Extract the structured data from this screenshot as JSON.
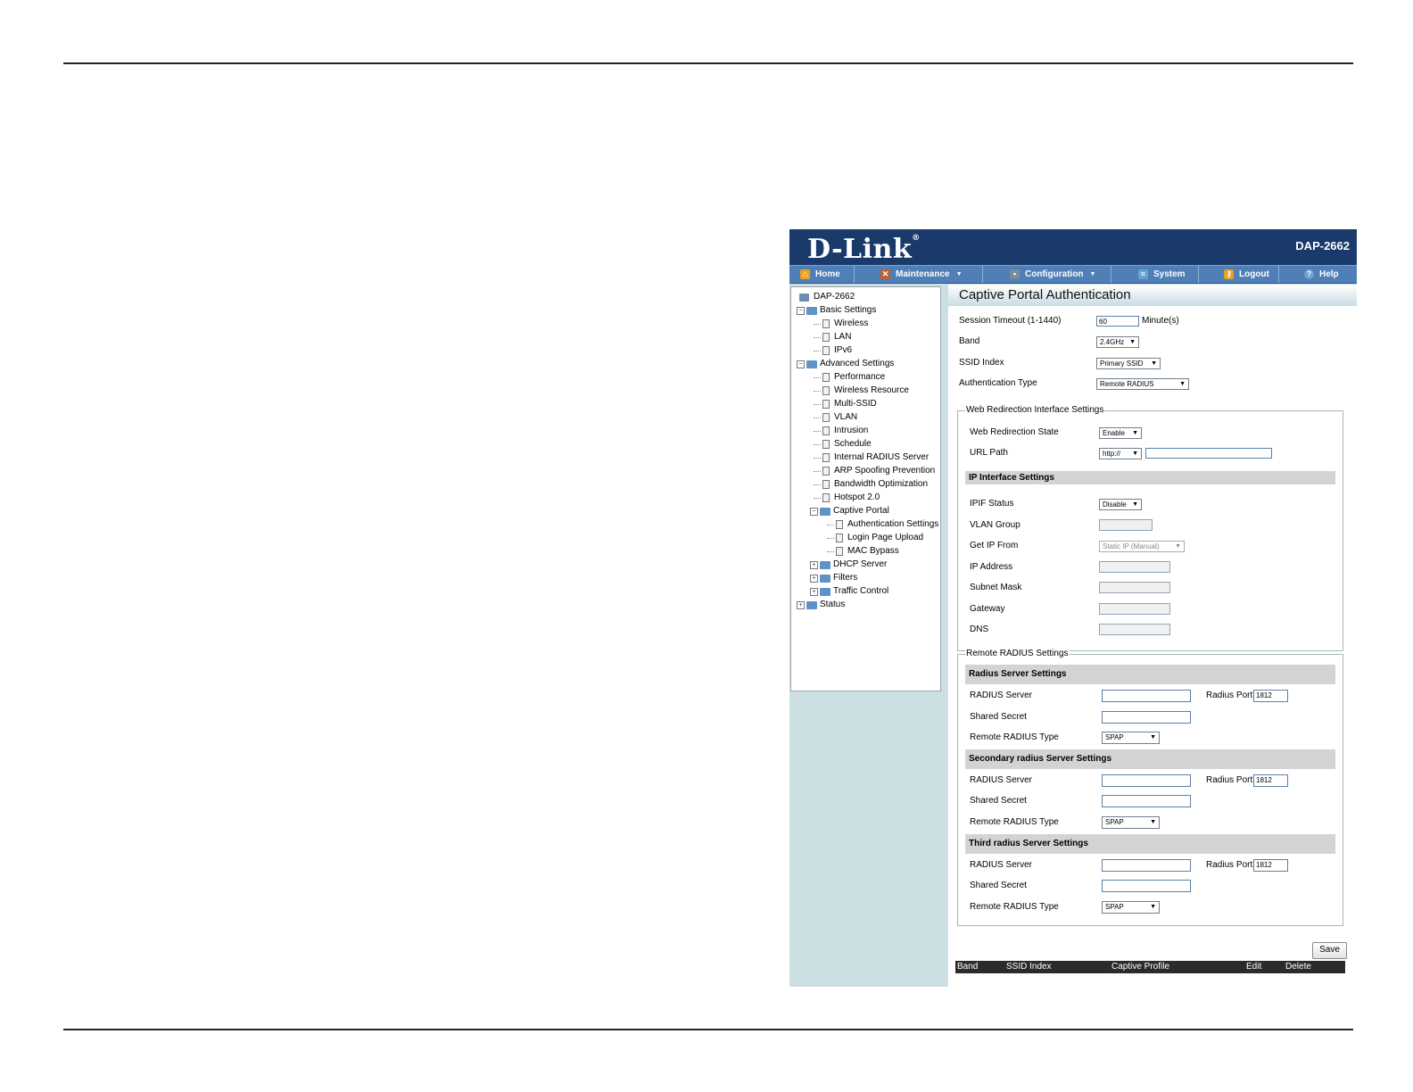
{
  "brand": {
    "logo": "D-Link",
    "reg": "®",
    "model": "DAP-2662"
  },
  "menu": [
    {
      "label": "Home",
      "icon": "home-icon",
      "color": "#f0a020",
      "dropdown": false
    },
    {
      "label": "Maintenance",
      "icon": "wrench-icon",
      "color": "#c06030",
      "dropdown": true
    },
    {
      "label": "Configuration",
      "icon": "save-disk-icon",
      "color": "#7a8ca0",
      "dropdown": true
    },
    {
      "label": "System",
      "icon": "system-icon",
      "color": "#6aa0d8",
      "dropdown": false
    },
    {
      "label": "Logout",
      "icon": "logout-key-icon",
      "color": "#e8a020",
      "dropdown": false
    },
    {
      "label": "Help",
      "icon": "help-icon",
      "color": "#6aa0d8",
      "dropdown": false
    }
  ],
  "tree": {
    "root": "DAP-2662",
    "basic_settings": "Basic Settings",
    "basic_items": [
      "Wireless",
      "LAN",
      "IPv6"
    ],
    "advanced_settings": "Advanced Settings",
    "advanced_items": [
      "Performance",
      "Wireless Resource",
      "Multi-SSID",
      "VLAN",
      "Intrusion",
      "Schedule",
      "Internal RADIUS Server",
      "ARP Spoofing Prevention",
      "Bandwidth Optimization",
      "Hotspot 2.0"
    ],
    "captive_portal": "Captive Portal",
    "captive_items": [
      "Authentication Settings",
      "Login Page Upload",
      "MAC Bypass"
    ],
    "dhcp_server": "DHCP Server",
    "filters": "Filters",
    "traffic_control": "Traffic Control",
    "status": "Status",
    "expand_minus": "−",
    "expand_plus": "+"
  },
  "page": {
    "title": "Captive Portal Authentication",
    "session_timeout_label": "Session Timeout (1-1440)",
    "session_timeout_value": "60",
    "minutes_label": "Minute(s)",
    "band_label": "Band",
    "band_value": "2.4GHz",
    "ssid_index_label": "SSID Index",
    "ssid_index_value": "Primary SSID",
    "auth_type_label": "Authentication Type",
    "auth_type_value": "Remote RADIUS"
  },
  "web_redirect": {
    "legend": "Web Redirection Interface Settings",
    "state_label": "Web Redirection State",
    "state_value": "Enable",
    "url_path_label": "URL Path",
    "url_scheme": "http://",
    "url_value": ""
  },
  "ip_interface": {
    "header": "IP Interface Settings",
    "ipif_status_label": "IPIF Status",
    "ipif_status_value": "Disable",
    "vlan_group_label": "VLAN Group",
    "get_ip_from_label": "Get IP From",
    "get_ip_from_value": "Static IP (Manual)",
    "ip_address_label": "IP Address",
    "subnet_mask_label": "Subnet Mask",
    "gateway_label": "Gateway",
    "dns_label": "DNS"
  },
  "radius": {
    "legend": "Remote RADIUS Settings",
    "server_label": "RADIUS Server",
    "port_label": "Radius Port",
    "secret_label": "Shared Secret",
    "type_label": "Remote RADIUS Type",
    "primary": {
      "header": "Radius Server Settings",
      "port": "1812",
      "type": "SPAP"
    },
    "secondary": {
      "header": "Secondary radius Server Settings",
      "port": "1812",
      "type": "SPAP"
    },
    "third": {
      "header": "Third radius Server Settings",
      "port": "1812",
      "type": "SPAP"
    }
  },
  "save_label": "Save",
  "table_headers": [
    "Band",
    "SSID Index",
    "Captive Profile",
    "Edit",
    "Delete"
  ]
}
